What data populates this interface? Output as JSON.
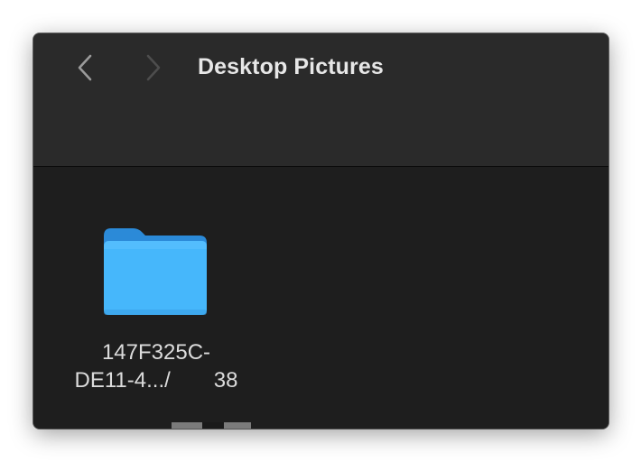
{
  "window": {
    "title": "Desktop Pictures"
  },
  "toolbar": {
    "back_icon": "chevron-left-icon",
    "forward_icon": "chevron-right-icon"
  },
  "items": [
    {
      "name_line1": "147F325C-",
      "name_line2": "DE11-4.../",
      "name_line2_end": "38",
      "icon": "folder-icon",
      "icon_color": "#3ea6f2"
    }
  ],
  "colors": {
    "window_bg": "#1e1e1e",
    "titlebar_bg": "#2a2a2a",
    "folder_blue": "#3ea6f2"
  }
}
